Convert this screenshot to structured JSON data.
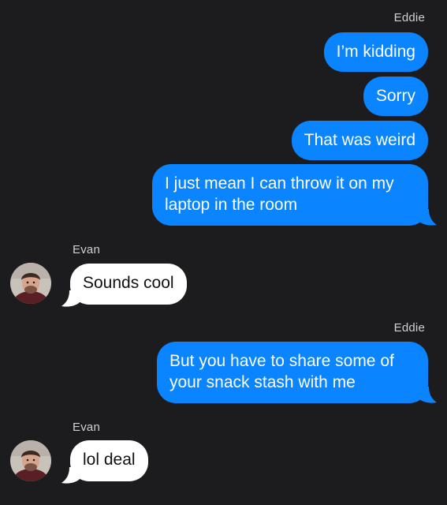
{
  "colors": {
    "background": "#1c1c1e",
    "outgoing_bubble": "#0a84ff",
    "incoming_bubble": "#ffffff",
    "sender_name": "#d0d0d4"
  },
  "conversation": {
    "group1": {
      "sender": "Eddie",
      "messages": [
        "I’m kidding",
        "Sorry",
        "That was weird",
        "I just mean I can throw it on my laptop in the room"
      ]
    },
    "group2": {
      "sender": "Evan",
      "messages": [
        "Sounds cool"
      ],
      "avatar_icon": "user-avatar-photo-icon"
    },
    "group3": {
      "sender": "Eddie",
      "messages": [
        "But you have to share some of your snack stash with me"
      ]
    },
    "group4": {
      "sender": "Evan",
      "messages": [
        "lol deal"
      ],
      "avatar_icon": "user-avatar-photo-icon"
    }
  }
}
